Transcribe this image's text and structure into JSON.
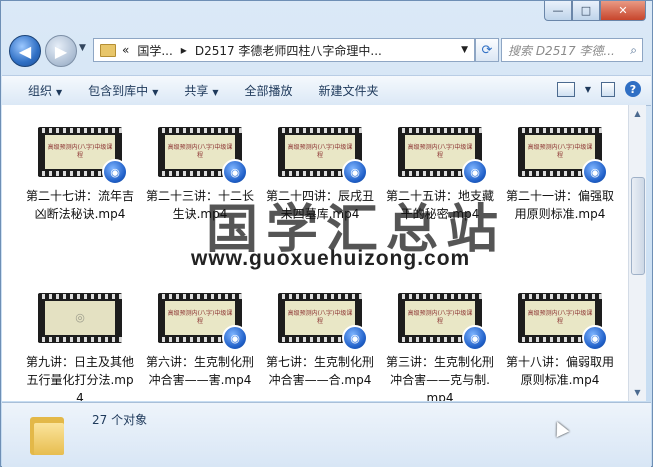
{
  "window": {
    "controls": {
      "minimize": "—",
      "maximize": "□",
      "close": "✕"
    }
  },
  "nav": {
    "back_icon": "◀",
    "forward_icon": "▶",
    "breadcrumb": [
      "«",
      "国学...",
      "▸",
      "D2517 李德老师四柱八字命理中..."
    ],
    "refresh_icon": "⟳",
    "search_placeholder": "搜索 D2517 李德...",
    "search_icon": "⌕"
  },
  "toolbar": {
    "organize": "组织",
    "include_library": "包含到库中",
    "share": "共享",
    "play_all": "全部播放",
    "new_folder": "新建文件夹",
    "help": "?"
  },
  "files": [
    {
      "label": "第二十七讲：流年吉凶断法秘诀.mp4",
      "thumb_title": "高级预测内(八字)中级课程"
    },
    {
      "label": "第二十三讲：十二长生诀.mp4",
      "thumb_title": "高级预测内(八字)中级课程"
    },
    {
      "label": "第二十四讲：辰戌丑未四墓库.mp4",
      "thumb_title": "高级预测内(八字)中级课程"
    },
    {
      "label": "第二十五讲：地支藏干的秘密.mp4",
      "thumb_title": "高级预测内(八字)中级课程"
    },
    {
      "label": "第二十一讲：偏强取用原则标准.mp4",
      "thumb_title": "高级预测内(八字)中级课程"
    },
    {
      "label": "第九讲：日主及其他五行量化打分法.mp4",
      "thumb_title": ""
    },
    {
      "label": "第六讲：生克制化刑冲合害——害.mp4",
      "thumb_title": "高级预测内(八字)中级课程"
    },
    {
      "label": "第七讲：生克制化刑冲合害——合.mp4",
      "thumb_title": "高级预测内(八字)中级课程"
    },
    {
      "label": "第三讲：生克制化刑冲合害——克与制.mp4",
      "thumb_title": "高级预测内(八字)中级课程"
    },
    {
      "label": "第十八讲：偏弱取用原则标准.mp4",
      "thumb_title": "高级预测内(八字)中级课程"
    }
  ],
  "watermark": {
    "cn": "国学汇总站",
    "url": "www.guoxuehuizong.com"
  },
  "status": {
    "count": "27 个对象"
  }
}
